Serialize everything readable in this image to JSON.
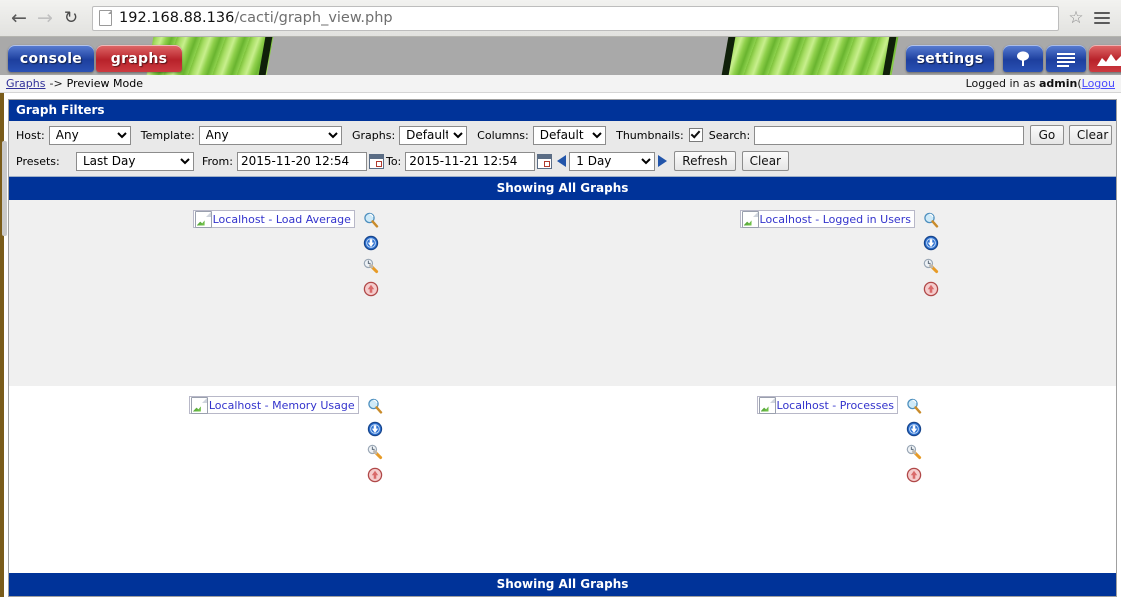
{
  "browser": {
    "back_icon": "back-arrow-icon",
    "forward_icon": "forward-arrow-icon",
    "reload_icon": "reload-icon",
    "page_icon": "page-icon",
    "url_host": "192.168.88.136",
    "url_path": "/cacti/graph_view.php",
    "url_full": "192.168.88.136/cacti/graph_view.php",
    "bookmark_icon": "star-icon",
    "menu_icon": "hamburger-menu-icon"
  },
  "banner": {
    "tabs": [
      {
        "label": "console",
        "name": "console"
      },
      {
        "label": "graphs",
        "name": "graphs"
      },
      {
        "label": "settings",
        "name": "settings"
      }
    ],
    "icon_buttons": [
      {
        "name": "tree-view-icon"
      },
      {
        "name": "list-view-icon"
      },
      {
        "name": "preview-view-icon"
      }
    ]
  },
  "breadcrumb": {
    "root": "Graphs",
    "separator": "->",
    "current": "Preview Mode",
    "login_prefix": "Logged in as",
    "login_user": "admin",
    "logout_open": "(",
    "logout_label": "Logou"
  },
  "filters": {
    "title": "Graph Filters",
    "host_label": "Host:",
    "host_value": "Any",
    "template_label": "Template:",
    "template_value": "Any",
    "graphs_label": "Graphs:",
    "graphs_value": "Default",
    "columns_label": "Columns:",
    "columns_value": "Default",
    "thumbnails_label": "Thumbnails:",
    "thumbnails_checked": true,
    "search_label": "Search:",
    "search_value": "",
    "go_label": "Go",
    "clear_label": "Clear",
    "presets_label": "Presets:",
    "presets_value": "Last Day",
    "from_label": "From:",
    "from_value": "2015-11-20 12:54",
    "to_label": "To:",
    "to_value": "2015-11-21 12:54",
    "span_value": "1 Day",
    "refresh_label": "Refresh",
    "clear2_label": "Clear",
    "calendar_icon": "calendar-icon",
    "prev_icon": "arrow-left-icon",
    "next_icon": "arrow-right-icon"
  },
  "content": {
    "showing_top": "Showing All Graphs",
    "showing_bottom": "Showing All Graphs",
    "graph_actions": [
      {
        "name": "zoom-graph-icon",
        "label": "Zoom Graph"
      },
      {
        "name": "csv-export-icon",
        "label": "CSV Export"
      },
      {
        "name": "graph-properties-icon",
        "label": "Graph Source/Properties"
      },
      {
        "name": "graph-debug-icon",
        "label": "Graph Debug"
      }
    ],
    "rows": [
      {
        "shade": "alt",
        "cells": [
          {
            "alt": "Localhost - Load Average",
            "broken_icon": "broken-image-icon"
          },
          {
            "alt": "Localhost - Logged in Users",
            "broken_icon": "broken-image-icon"
          }
        ]
      },
      {
        "shade": "plain",
        "cells": [
          {
            "alt": "Localhost - Memory Usage",
            "broken_icon": "broken-image-icon"
          },
          {
            "alt": "Localhost - Processes",
            "broken_icon": "broken-image-icon"
          }
        ]
      }
    ]
  },
  "colors": {
    "cacti_blue": "#003399",
    "tab_red": "#b8222a",
    "link_blue": "#3333cc",
    "banner_gray": "#a9a9a9",
    "row_alt": "#f0f0f0"
  }
}
